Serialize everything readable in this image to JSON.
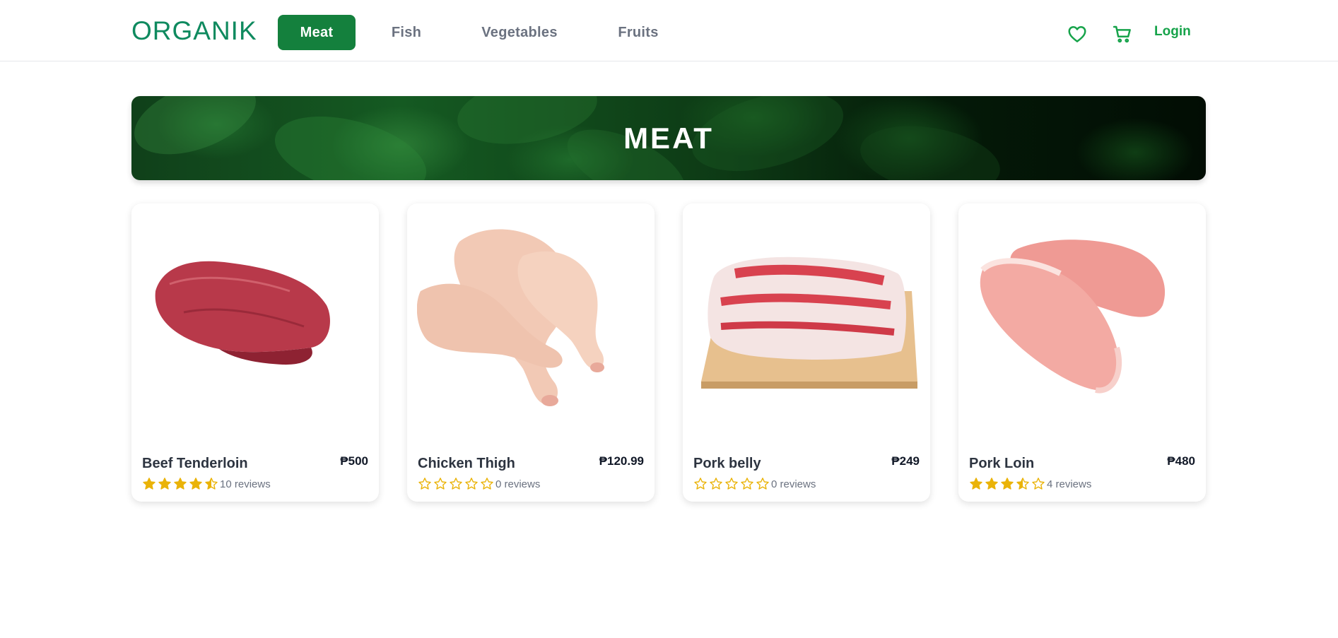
{
  "brand": {
    "logo": "ORGANIK",
    "accent": "#14803d"
  },
  "nav": {
    "items": [
      {
        "label": "Meat",
        "active": true
      },
      {
        "label": "Fish",
        "active": false
      },
      {
        "label": "Vegetables",
        "active": false
      },
      {
        "label": "Fruits",
        "active": false
      }
    ],
    "wishlist_icon": "heart-icon",
    "cart_icon": "cart-icon",
    "login_label": "Login"
  },
  "banner": {
    "title": "MEAT"
  },
  "products": [
    {
      "name": "Beef Tenderloin",
      "price": "₱500",
      "rating": 4.5,
      "reviews": "10 reviews",
      "image": "beef-tenderloin-image"
    },
    {
      "name": "Chicken Thigh",
      "price": "₱120.99",
      "rating": 0,
      "reviews": "0 reviews",
      "image": "chicken-thigh-image"
    },
    {
      "name": "Pork belly",
      "price": "₱249",
      "rating": 0,
      "reviews": "0 reviews",
      "image": "pork-belly-image"
    },
    {
      "name": "Pork Loin",
      "price": "₱480",
      "rating": 3.5,
      "reviews": "4 reviews",
      "image": "pork-loin-image"
    }
  ],
  "colors": {
    "star": "#eab308",
    "login": "#16a34a"
  }
}
